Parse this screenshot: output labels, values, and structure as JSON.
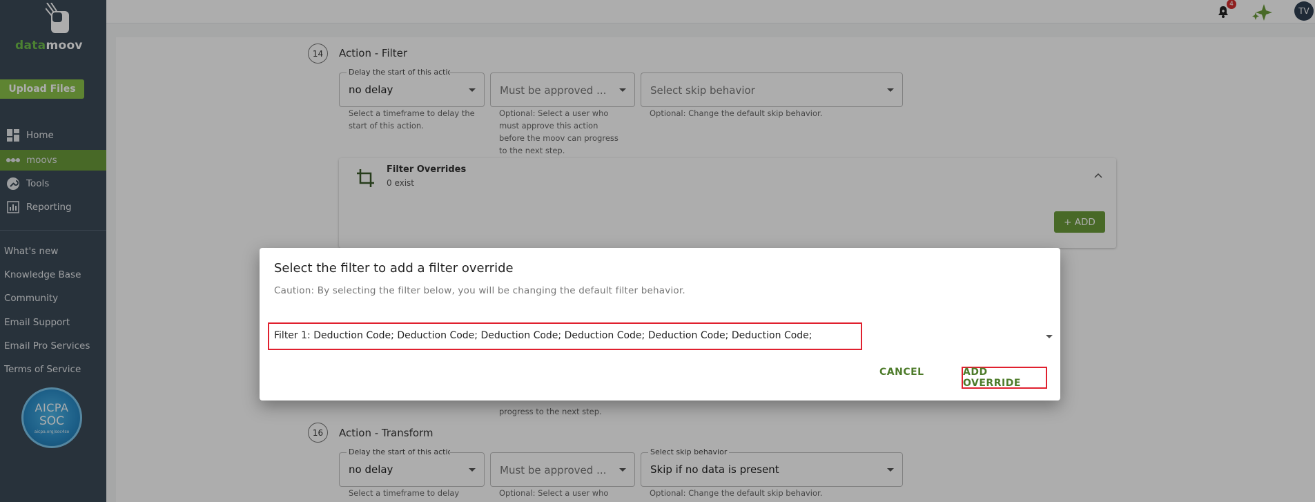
{
  "app": {
    "logo_green": "data",
    "logo_white": "moov",
    "upload_label": "Upload Files"
  },
  "sidebar": {
    "nav": [
      {
        "label": "Home",
        "icon": "dashboard-icon"
      },
      {
        "label": "moovs",
        "icon": "moovs-icon",
        "active": true
      },
      {
        "label": "Tools",
        "icon": "wrench-icon"
      },
      {
        "label": "Reporting",
        "icon": "chart-icon"
      }
    ],
    "links": [
      "What's new",
      "Knowledge Base",
      "Community",
      "Email Support",
      "Email Pro Services",
      "Terms of Service"
    ],
    "badge": {
      "line1": "AICPA",
      "line2": "SOC",
      "line3": "aicpa.org/soc4so"
    }
  },
  "topbar": {
    "notification_count": "4",
    "avatar_initials": "TV"
  },
  "steps": [
    {
      "number": "14",
      "title": "Action - Filter",
      "delay_legend": "Delay the start of this action",
      "delay_value": "no delay",
      "delay_help": "Select a timeframe to delay the start of this action.",
      "approve_placeholder": "Must be approved ...",
      "approve_help": "Optional: Select a user who must approve this action before the moov can progress to the next step.",
      "skip_placeholder": "Select skip behavior",
      "skip_help": "Optional: Change the default skip behavior."
    },
    {
      "number": "16",
      "title": "Action - Transform",
      "delay_legend": "Delay the start of this action",
      "delay_value": "no delay",
      "delay_help": "Select a timeframe to delay",
      "approve_placeholder": "Must be approved ...",
      "approve_help": "Optional: Select a user who",
      "skip_legend": "Select skip behavior",
      "skip_value": "Skip if no data is present",
      "skip_help": "Optional: Change the default skip behavior."
    }
  ],
  "partial_help": "progress to the next step.",
  "overrides": {
    "title": "Filter Overrides",
    "count": "0 exist",
    "add_label": "+ ADD"
  },
  "dialog": {
    "title": "Select the filter to add a filter override",
    "caution": "Caution: By selecting the filter below, you will be changing the default filter behavior.",
    "selected": "Filter 1: Deduction Code; Deduction Code; Deduction Code; Deduction Code; Deduction Code; Deduction Code;",
    "cancel_label": "CANCEL",
    "confirm_label": "ADD OVERRIDE"
  }
}
